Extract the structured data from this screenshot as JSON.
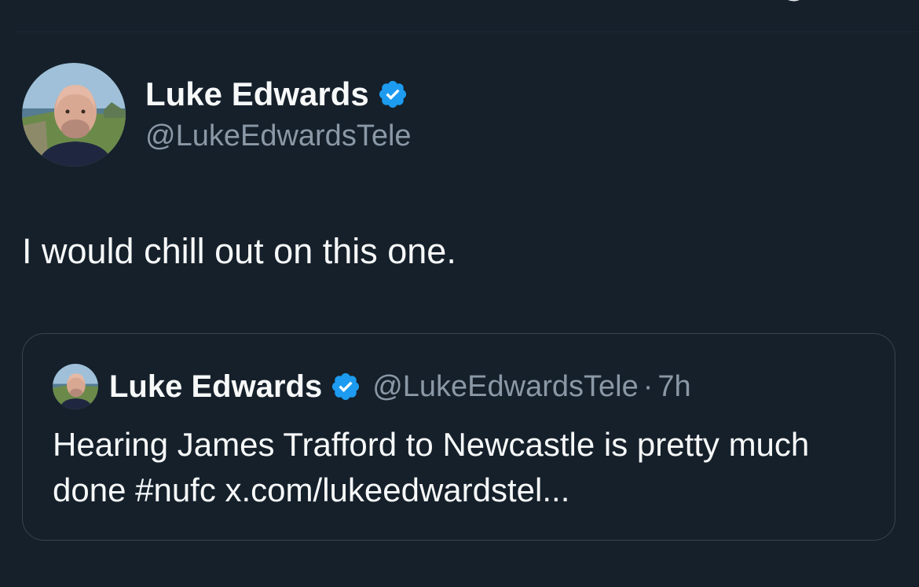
{
  "tweet": {
    "author": {
      "display_name": "Luke Edwards",
      "handle": "@LukeEdwardsTele",
      "verified_icon": "verified-badge-icon"
    },
    "text": "I would chill out on this one."
  },
  "quoted_tweet": {
    "author": {
      "display_name": "Luke Edwards",
      "handle": "@LukeEdwardsTele",
      "verified_icon": "verified-badge-icon"
    },
    "separator": "·",
    "time": "7h",
    "text": "Hearing James Trafford to Newcastle is pretty much done #nufc x.com/lukeedwardstel..."
  },
  "colors": {
    "background": "#15202b",
    "text_primary": "#f7f9f9",
    "text_secondary": "#8b98a5",
    "verified_blue": "#1d9bf0",
    "border": "#38444d"
  }
}
